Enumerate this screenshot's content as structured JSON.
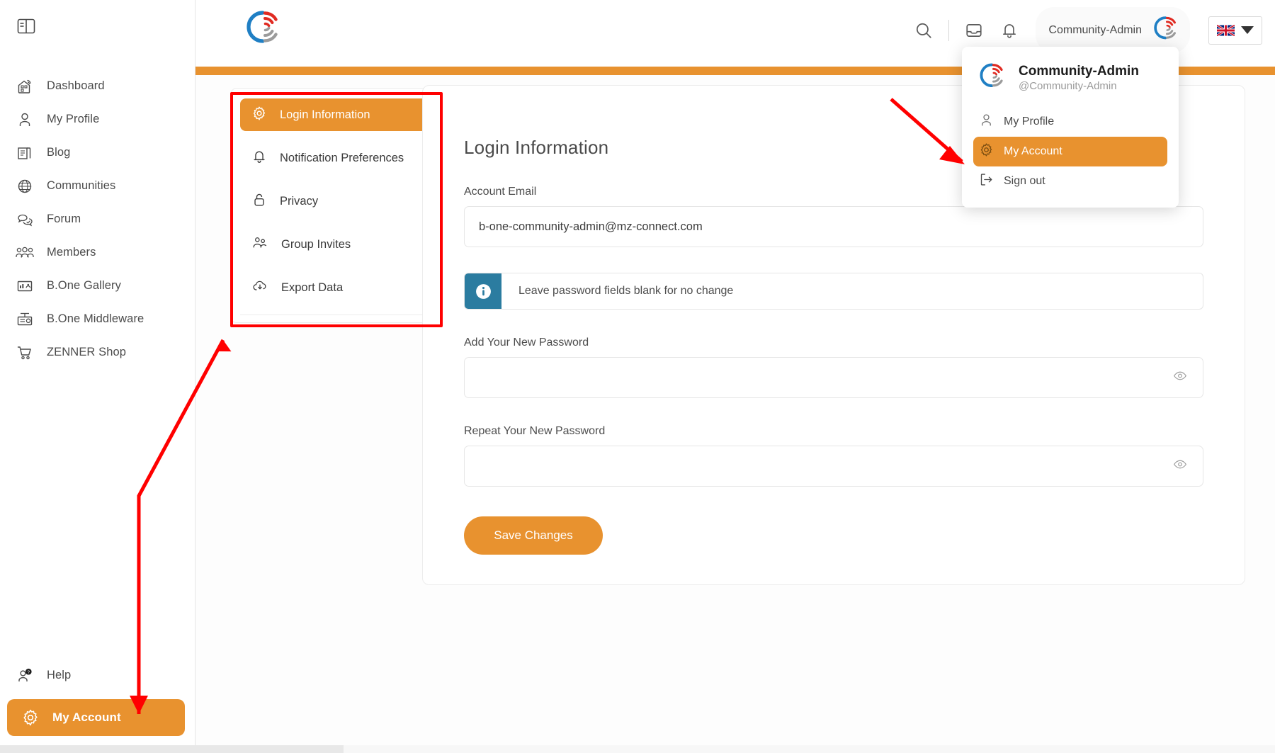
{
  "colors": {
    "accent_orange": "#E8922F",
    "info_teal": "#2B7CA0",
    "annotation_red": "#FF0000",
    "text_gray": "#4b4b4b"
  },
  "sidebar": {
    "toggle_icon": "panel-toggle-icon",
    "items": [
      {
        "label": "Dashboard",
        "icon": "dashboard-icon"
      },
      {
        "label": "My Profile",
        "icon": "user-icon"
      },
      {
        "label": "Blog",
        "icon": "blog-icon"
      },
      {
        "label": "Communities",
        "icon": "globe-icon"
      },
      {
        "label": "Forum",
        "icon": "forum-icon"
      },
      {
        "label": "Members",
        "icon": "members-icon"
      },
      {
        "label": "B.One Gallery",
        "icon": "gallery-icon"
      },
      {
        "label": "B.One Middleware",
        "icon": "middleware-icon"
      },
      {
        "label": "ZENNER Shop",
        "icon": "cart-icon"
      }
    ],
    "bottom_items": [
      {
        "label": "Help",
        "icon": "help-user-icon",
        "active": false
      },
      {
        "label": "My Account",
        "icon": "gear-icon",
        "active": true
      }
    ]
  },
  "header": {
    "logo_icon": "b-one-connect-logo",
    "search_icon": "search-icon",
    "inbox_icon": "inbox-icon",
    "notifications_icon": "bell-icon",
    "user_name": "Community-Admin",
    "user_avatar_icon": "b-one-connect-avatar",
    "language": {
      "flag_icon": "uk-flag-icon",
      "caret_icon": "chevron-down-icon"
    }
  },
  "user_menu": {
    "avatar_icon": "b-one-connect-avatar",
    "display_name": "Community-Admin",
    "handle": "@Community-Admin",
    "items": [
      {
        "label": "My Profile",
        "icon": "user-icon",
        "active": false
      },
      {
        "label": "My Account",
        "icon": "gear-icon",
        "active": true
      },
      {
        "label": "Sign out",
        "icon": "sign-out-icon",
        "active": false
      }
    ]
  },
  "settings_nav": {
    "items": [
      {
        "label": "Login Information",
        "icon": "gear-icon",
        "active": true
      },
      {
        "label": "Notification Preferences",
        "icon": "bell-icon",
        "active": false
      },
      {
        "label": "Privacy",
        "icon": "lock-icon",
        "active": false
      },
      {
        "label": "Group Invites",
        "icon": "group-invites-icon",
        "active": false
      },
      {
        "label": "Export Data",
        "icon": "cloud-download-icon",
        "active": false
      }
    ]
  },
  "main": {
    "title": "Login Information",
    "account_email_label": "Account Email",
    "account_email_value": "b-one-community-admin@mz-connect.com",
    "notice_icon": "info-icon",
    "notice_text": "Leave password fields blank for no change",
    "new_password_label": "Add Your New Password",
    "new_password_value": "",
    "new_password_placeholder": "",
    "repeat_password_label": "Repeat Your New Password",
    "repeat_password_value": "",
    "repeat_password_placeholder": "",
    "reveal_icon": "eye-icon",
    "save_label": "Save Changes"
  },
  "annotations": {
    "settings_nav_highlight": "red-rectangle-around-settings-nav",
    "arrow_to_settings_nav": "red-arrow-from-my-account-to-settings-nav",
    "arrow_to_my_account_menu": "red-arrow-to-my-account-menu-item",
    "arrow_to_sidebar_my_account": "red-arrow-down-to-sidebar-my-account"
  }
}
